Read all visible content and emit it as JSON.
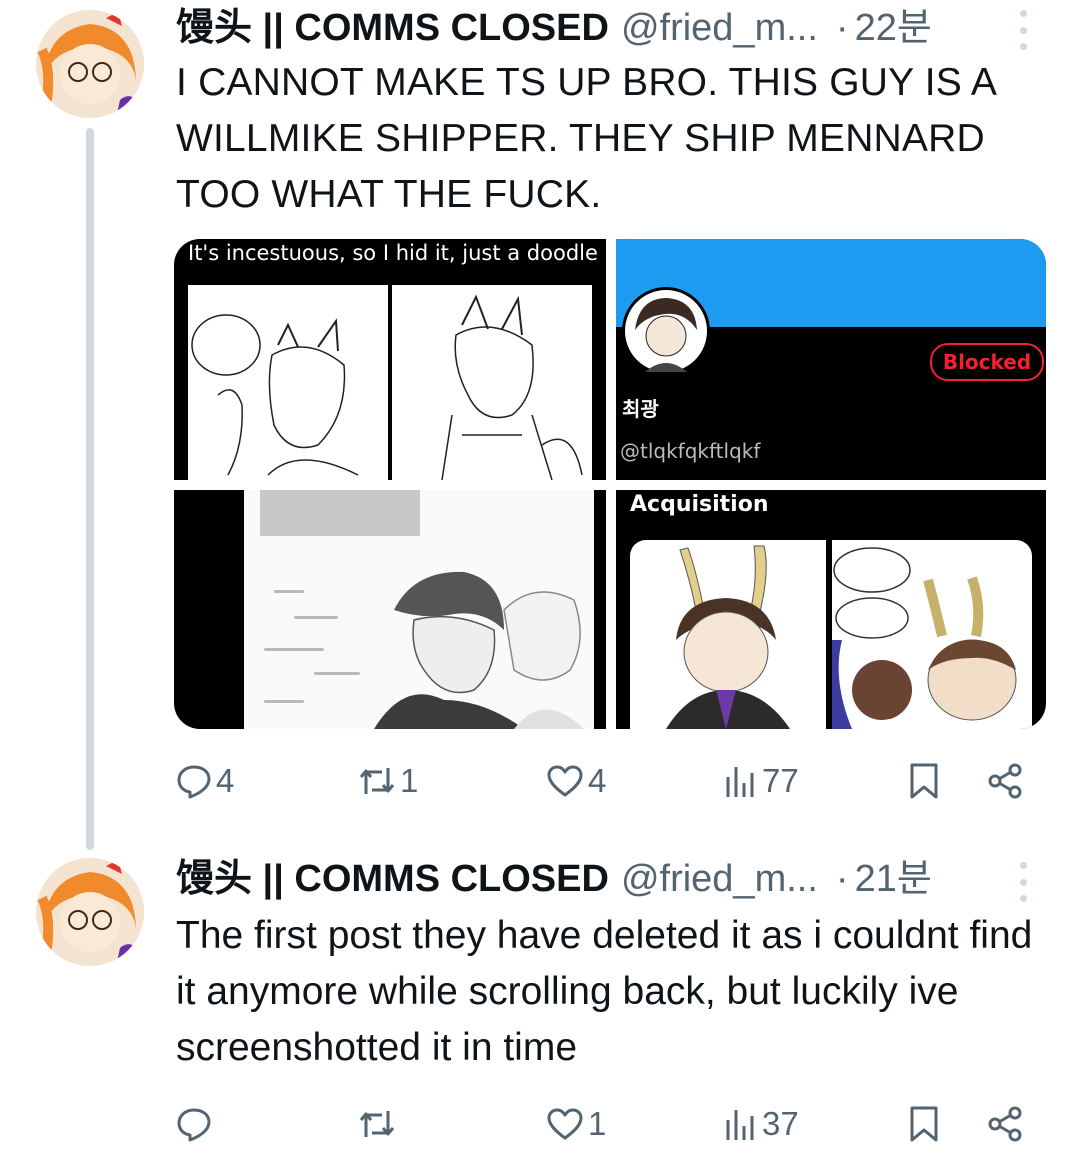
{
  "posts": [
    {
      "author_name": "馒头 || COMMS CLOSED",
      "handle": "@fried_m...",
      "separator": "·",
      "time": "22분",
      "text": "I CANNOT MAKE TS UP BRO. THIS GUY IS A WILLMIKE SHIPPER. THEY SHIP MENNARD TOO WHAT THE FUCK.",
      "media": {
        "image1_caption": "It's incestuous, so I hid it, just a doodle",
        "image2_button": "Blocked",
        "image2_name": "최광",
        "image2_handle": "@tlqkfqkftlqkf",
        "image4_caption": "Acquisition"
      },
      "actions": {
        "replies": "4",
        "reposts": "1",
        "likes": "4",
        "views": "77"
      }
    },
    {
      "author_name": "馒头 || COMMS CLOSED",
      "handle": "@fried_m...",
      "separator": "·",
      "time": "21분",
      "text": "The first post they have deleted it as i couldnt find it anymore while scrolling back, but luckily ive screenshotted it in time",
      "actions": {
        "replies": "",
        "reposts": "",
        "likes": "1",
        "views": "37"
      }
    }
  ],
  "colors": {
    "text": "#0f1419",
    "secondary": "#536471",
    "thread_line": "#cfd9de",
    "blocked": "#f4212e",
    "banner": "#1d9bf0"
  },
  "icons": [
    "reply-icon",
    "repost-icon",
    "like-icon",
    "views-icon",
    "bookmark-icon",
    "share-icon",
    "more-icon"
  ]
}
